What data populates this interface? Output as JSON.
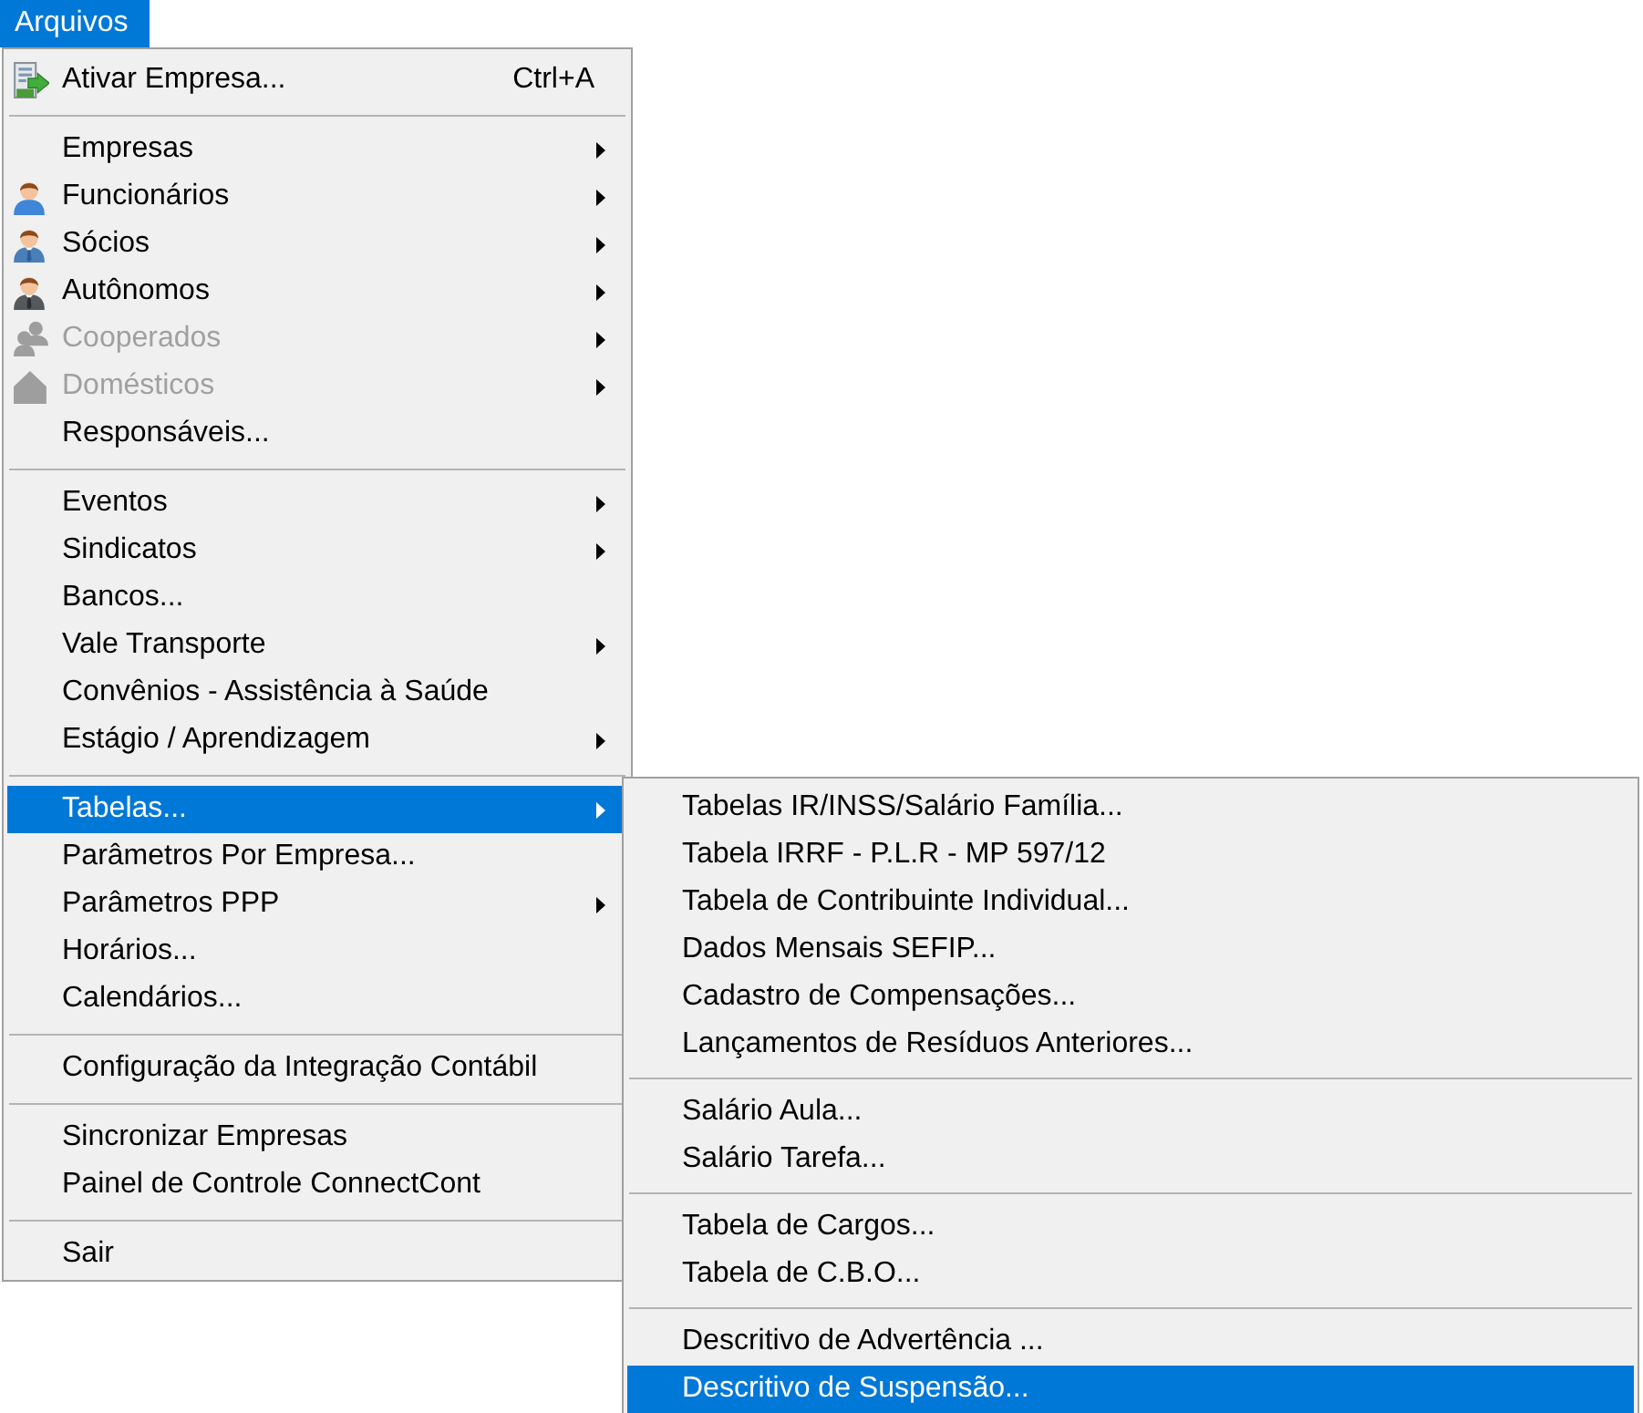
{
  "menu_bar": {
    "items": [
      {
        "label": "Arquivos",
        "selected": true
      }
    ]
  },
  "menu": {
    "sections": [
      {
        "items": [
          {
            "kind": "company",
            "label": "Ativar Empresa...",
            "shortcut": "Ctrl+A",
            "has_submenu": false,
            "disabled": false,
            "selected": false
          }
        ]
      },
      {
        "items": [
          {
            "kind": "plain",
            "label": "Empresas",
            "has_submenu": true,
            "disabled": false,
            "selected": false
          },
          {
            "kind": "employee",
            "label": "Funcionários",
            "has_submenu": true,
            "disabled": false,
            "selected": false
          },
          {
            "kind": "partner",
            "label": "Sócios",
            "has_submenu": true,
            "disabled": false,
            "selected": false
          },
          {
            "kind": "autonomous",
            "label": "Autônomos",
            "has_submenu": true,
            "disabled": false,
            "selected": false
          },
          {
            "kind": "cooperative",
            "label": "Cooperados",
            "has_submenu": true,
            "disabled": true,
            "selected": false
          },
          {
            "kind": "domestic",
            "label": "Domésticos",
            "has_submenu": true,
            "disabled": true,
            "selected": false
          },
          {
            "kind": "plain",
            "label": "Responsáveis...",
            "has_submenu": false,
            "disabled": false,
            "selected": false
          }
        ]
      },
      {
        "items": [
          {
            "kind": "plain",
            "label": "Eventos",
            "has_submenu": true,
            "disabled": false,
            "selected": false
          },
          {
            "kind": "plain",
            "label": "Sindicatos",
            "has_submenu": true,
            "disabled": false,
            "selected": false
          },
          {
            "kind": "plain",
            "label": "Bancos...",
            "has_submenu": false,
            "disabled": false,
            "selected": false
          },
          {
            "kind": "plain",
            "label": "Vale Transporte",
            "has_submenu": true,
            "disabled": false,
            "selected": false
          },
          {
            "kind": "plain",
            "label": "Convênios - Assistência à Saúde",
            "has_submenu": false,
            "disabled": false,
            "selected": false
          },
          {
            "kind": "plain",
            "label": "Estágio / Aprendizagem",
            "has_submenu": true,
            "disabled": false,
            "selected": false
          }
        ]
      },
      {
        "items": [
          {
            "kind": "plain",
            "label": "Tabelas...",
            "has_submenu": true,
            "disabled": false,
            "selected": true
          },
          {
            "kind": "plain",
            "label": "Parâmetros Por Empresa...",
            "has_submenu": false,
            "disabled": false,
            "selected": false
          },
          {
            "kind": "plain",
            "label": "Parâmetros PPP",
            "has_submenu": true,
            "disabled": false,
            "selected": false
          },
          {
            "kind": "plain",
            "label": "Horários...",
            "has_submenu": false,
            "disabled": false,
            "selected": false
          },
          {
            "kind": "plain",
            "label": "Calendários...",
            "has_submenu": false,
            "disabled": false,
            "selected": false
          }
        ]
      },
      {
        "items": [
          {
            "kind": "plain",
            "label": "Configuração da Integração Contábil",
            "has_submenu": false,
            "disabled": false,
            "selected": false
          }
        ]
      },
      {
        "items": [
          {
            "kind": "plain",
            "label": "Sincronizar Empresas",
            "has_submenu": false,
            "disabled": false,
            "selected": false
          },
          {
            "kind": "plain",
            "label": "Painel de Controle ConnectCont",
            "has_submenu": false,
            "disabled": false,
            "selected": false
          }
        ]
      },
      {
        "items": [
          {
            "kind": "plain",
            "label": "Sair",
            "has_submenu": false,
            "disabled": false,
            "selected": false
          }
        ]
      }
    ]
  },
  "submenu": {
    "sections": [
      {
        "items": [
          {
            "label": "Tabelas IR/INSS/Salário Família...",
            "selected": false
          },
          {
            "label": "Tabela IRRF - P.L.R - MP 597/12",
            "selected": false
          },
          {
            "label": "Tabela de Contribuinte Individual...",
            "selected": false
          },
          {
            "label": "Dados Mensais SEFIP...",
            "selected": false
          },
          {
            "label": "Cadastro de Compensações...",
            "selected": false
          },
          {
            "label": "Lançamentos de Resíduos Anteriores...",
            "selected": false
          }
        ]
      },
      {
        "items": [
          {
            "label": "Salário Aula...",
            "selected": false
          },
          {
            "label": "Salário Tarefa...",
            "selected": false
          }
        ]
      },
      {
        "items": [
          {
            "label": "Tabela de Cargos...",
            "selected": false
          },
          {
            "label": "Tabela de C.B.O...",
            "selected": false
          }
        ]
      },
      {
        "items": [
          {
            "label": "Descritivo de Advertência ...",
            "selected": false
          },
          {
            "label": "Descritivo de Suspensão...",
            "selected": true
          }
        ]
      }
    ]
  }
}
